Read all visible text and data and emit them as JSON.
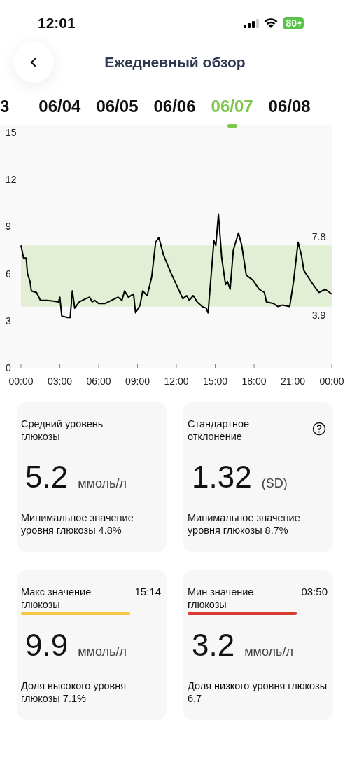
{
  "status_bar": {
    "time": "12:01",
    "battery": "80"
  },
  "header": {
    "title": "Ежедневный обзор"
  },
  "dates": [
    {
      "label": "3",
      "selected": false
    },
    {
      "label": "06/04",
      "selected": false
    },
    {
      "label": "06/05",
      "selected": false
    },
    {
      "label": "06/06",
      "selected": false
    },
    {
      "label": "06/07",
      "selected": true
    },
    {
      "label": "06/08",
      "selected": false
    }
  ],
  "chart_data": {
    "type": "line",
    "x": [
      0,
      0.2,
      0.4,
      0.5,
      0.7,
      0.8,
      1.2,
      1.5,
      2,
      2.5,
      2.9,
      3.0,
      3.15,
      3.6,
      3.8,
      3.97,
      4.15,
      4.5,
      5.0,
      5.3,
      5.5,
      5.7,
      6.0,
      6.5,
      7.0,
      7.5,
      7.8,
      8.0,
      8.3,
      8.7,
      8.85,
      9.2,
      9.4,
      9.75,
      10.1,
      10.4,
      10.65,
      11.0,
      11.5,
      12.0,
      12.5,
      12.8,
      13.0,
      13.3,
      13.6,
      14.0,
      14.3,
      14.45,
      14.9,
      15.05,
      15.25,
      15.5,
      15.8,
      15.95,
      16.15,
      16.4,
      16.8,
      17.05,
      17.4,
      17.9,
      18.4,
      18.8,
      18.95,
      19.5,
      19.85,
      20.2,
      20.75,
      21.05,
      21.4,
      21.65,
      21.85,
      22.4,
      23.0,
      23.5,
      24
    ],
    "series": [
      {
        "color": "#000000",
        "values": [
          7.8,
          7.0,
          7.0,
          6.0,
          5.5,
          4.9,
          4.8,
          4.3,
          4.3,
          4.25,
          4.2,
          4.5,
          3.3,
          3.2,
          3.2,
          4.9,
          3.8,
          4.2,
          4.4,
          4.5,
          4.2,
          4.3,
          4.1,
          4.1,
          4.3,
          4.5,
          4.3,
          4.9,
          4.5,
          4.7,
          3.5,
          4.0,
          4.9,
          4.6,
          5.8,
          8.0,
          8.3,
          7.2,
          6.2,
          5.3,
          4.4,
          4.6,
          4.3,
          4.6,
          4.2,
          3.9,
          3.8,
          3.5,
          8.1,
          7.8,
          9.8,
          7.0,
          5.3,
          5.5,
          5.0,
          7.5,
          8.6,
          7.8,
          5.9,
          5.6,
          5.0,
          4.8,
          4.2,
          4.1,
          3.9,
          4.0,
          3.9,
          5.5,
          8.0,
          7.2,
          6.2,
          5.5,
          4.8,
          5.0,
          4.7
        ]
      }
    ],
    "xlim": [
      0,
      24
    ],
    "ylim": [
      0,
      15
    ],
    "xticks": [
      {
        "value": 0,
        "label": "00:00"
      },
      {
        "value": 3,
        "label": "03:00"
      },
      {
        "value": 6,
        "label": "06:00"
      },
      {
        "value": 9,
        "label": "09:00"
      },
      {
        "value": 12,
        "label": "12:00"
      },
      {
        "value": 15,
        "label": "15:00"
      },
      {
        "value": 18,
        "label": "18:00"
      },
      {
        "value": 21,
        "label": "21:00"
      },
      {
        "value": 24,
        "label": "00:00"
      }
    ],
    "yticks": [
      0,
      3,
      6,
      9,
      12,
      15
    ],
    "bands": [
      {
        "axis": "y",
        "from": 3.9,
        "to": 7.8,
        "color": "#e3efd4"
      }
    ],
    "annotations": [
      "7.8",
      "3.9"
    ]
  },
  "cards": [
    {
      "title": "Средний уровень глюкозы",
      "value": "5.2",
      "unit": "ммоль/л",
      "footer": "Минимальное значение уровня глюкозы 4.8%",
      "help": false
    },
    {
      "title": "Стандартное отклонение",
      "value": "1.32",
      "unit": "(SD)",
      "footer": "Минимальное значение уровня глюкозы 8.7%",
      "help": true
    },
    {
      "title": "Макс значение глюкозы",
      "time": "15:14",
      "color": "#f5c842",
      "value": "9.9",
      "unit": "ммоль/л",
      "footer": "Доля высокого уровня глюкозы 7.1%",
      "help": false
    },
    {
      "title": "Мин значение глюкозы",
      "time": "03:50",
      "color": "#d93a32",
      "value": "3.2",
      "unit": "ммоль/л",
      "footer": "Доля низкого уровня глюкозы 6.7",
      "help": false
    }
  ]
}
